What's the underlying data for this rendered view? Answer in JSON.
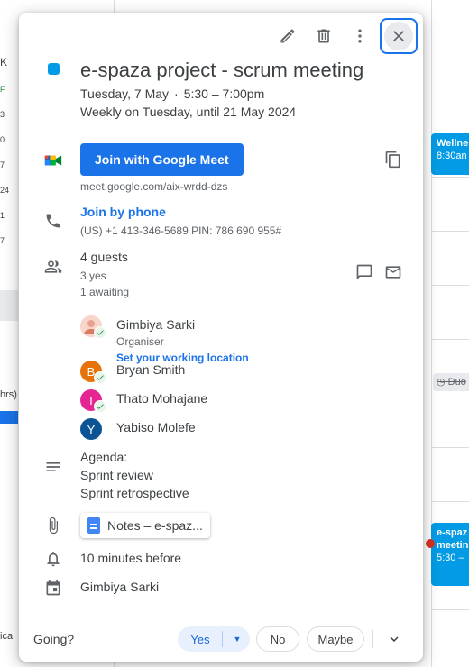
{
  "background": {
    "left_nums": [
      "K",
      "F",
      "3",
      "0",
      "7",
      "24",
      "1",
      "7"
    ],
    "left_hrs": "hrs)",
    "left_bottom": "ica",
    "event_wellness": {
      "title": "Wellne",
      "time": "8:30an"
    },
    "event_scrum": {
      "title": "e-spaz",
      "title2": "meetin",
      "time": "5:30 –"
    },
    "pill_text": "Duo"
  },
  "dialog": {
    "title": "e-spaza project - scrum meeting",
    "date": "Tuesday, 7 May",
    "time": "5:30 – 7:00pm",
    "recurrence": "Weekly on Tuesday, until 21 May 2024",
    "meet": {
      "button_label": "Join with Google Meet",
      "url": "meet.google.com/aix-wrdd-dzs"
    },
    "phone": {
      "link": "Join by phone",
      "details": "(US) +1 413-346-5689 PIN: 786 690 955#"
    },
    "guests": {
      "count": "4 guests",
      "yes": "3 yes",
      "awaiting": "1 awaiting",
      "list": [
        {
          "name": "Gimbiya Sarki",
          "role": "Organiser",
          "link": "Set your working location"
        },
        {
          "name": "Bryan Smith",
          "initial": "B",
          "color": "#e8710a"
        },
        {
          "name": "Thato Mohajane",
          "initial": "T",
          "color": "#e52592"
        },
        {
          "name": "Yabiso Molefe",
          "initial": "Y",
          "color": "#0b5394"
        }
      ]
    },
    "description": {
      "line1": "Agenda:",
      "line2": "Sprint review",
      "line3": "Sprint retrospective"
    },
    "attachment": "Notes – e-spaz...",
    "reminder": "10 minutes before",
    "calendar_owner": "Gimbiya Sarki",
    "footer": {
      "going_label": "Going?",
      "yes": "Yes",
      "no": "No",
      "maybe": "Maybe"
    }
  }
}
